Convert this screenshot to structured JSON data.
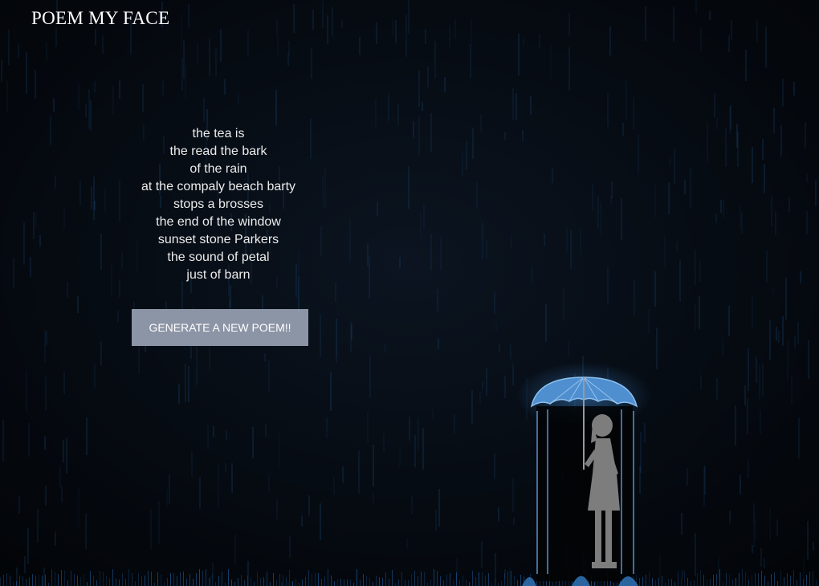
{
  "header": {
    "title": "POEM MY FACE"
  },
  "poem": {
    "lines": [
      "the tea is",
      "the read the bark",
      "of the rain",
      "at the compaly beach barty",
      "stops a brosses",
      "the end of the window",
      "sunset stone Parkers",
      "the sound of petal",
      "just of barn"
    ]
  },
  "actions": {
    "generate_label": "GENERATE A NEW POEM!!"
  },
  "colors": {
    "background": "#05080d",
    "rain": "#1c4a7a",
    "button": "#8c95a6",
    "umbrella": "#4f8fd0",
    "figure": "#7d7d7d"
  }
}
